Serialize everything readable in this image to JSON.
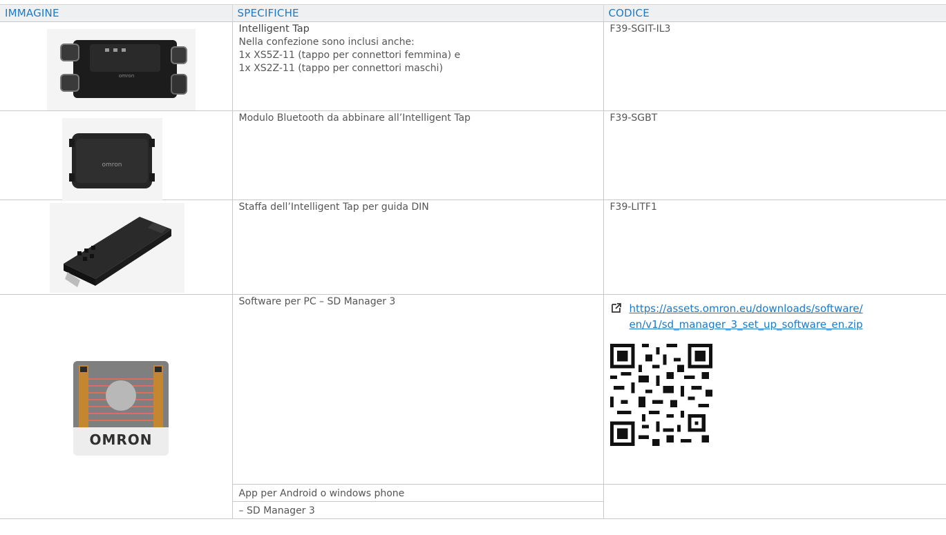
{
  "table": {
    "headers": {
      "image": "IMMAGINE",
      "specs": "SPECIFICHE",
      "code": "CODICE"
    },
    "rows": [
      {
        "title": "Intelligent Tap",
        "lines": [
          "Nella confezione sono inclusi anche:",
          "1x XS5Z-11 (tappo per connettori femmina) e",
          "1x XS2Z-11 (tappo per connettori maschi)"
        ],
        "code": "F39-SGIT-IL3",
        "image_icon": "intelligent-tap-photo"
      },
      {
        "spec": "Modulo Bluetooth da abbinare all’Intelligent Tap",
        "code": "F39-SGBT",
        "image_icon": "bluetooth-module-photo"
      },
      {
        "spec": "Staffa dell’Intelligent Tap per guida DIN",
        "code": "F39-LITF1",
        "image_icon": "din-rail-bracket-photo"
      },
      {
        "spec": "Software per PC – SD Manager 3",
        "link_line1": "https://assets.omron.eu/downloads/software/",
        "link_line2": "en/v1/sd_manager_3_set_up_software_en.zip",
        "app_logo_text": "OMRON",
        "image_icon": "sd-manager-app-logo"
      },
      {
        "spec_a": "App per Android o windows phone",
        "spec_b": "– SD Manager 3"
      }
    ]
  },
  "brand": {
    "logo_text": "OMRON",
    "link_color": "#1a7ac8",
    "header_bg": "#eef0f2"
  }
}
